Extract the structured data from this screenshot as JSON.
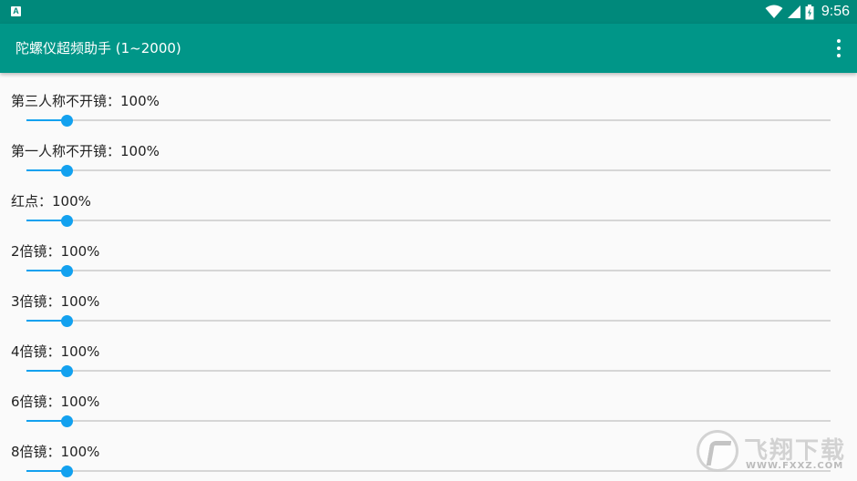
{
  "status_bar": {
    "time": "9:56",
    "app_icon_letter": "A",
    "icons": [
      "notification-icon",
      "wifi-icon",
      "signal-icon",
      "battery-icon"
    ]
  },
  "app_bar": {
    "title": "陀螺仪超频助手 (1~2000)",
    "overflow_icon": "more-vert-icon"
  },
  "sliders": [
    {
      "label": "第三人称不开镜：100%",
      "value": 100,
      "min": 1,
      "max": 2000
    },
    {
      "label": "第一人称不开镜：100%",
      "value": 100,
      "min": 1,
      "max": 2000
    },
    {
      "label": "红点：100%",
      "value": 100,
      "min": 1,
      "max": 2000
    },
    {
      "label": "2倍镜：100%",
      "value": 100,
      "min": 1,
      "max": 2000
    },
    {
      "label": "3倍镜：100%",
      "value": 100,
      "min": 1,
      "max": 2000
    },
    {
      "label": "4倍镜：100%",
      "value": 100,
      "min": 1,
      "max": 2000
    },
    {
      "label": "6倍镜：100%",
      "value": 100,
      "min": 1,
      "max": 2000
    },
    {
      "label": "8倍镜：100%",
      "value": 100,
      "min": 1,
      "max": 2000
    }
  ],
  "colors": {
    "status_bar": "#00897b",
    "app_bar": "#009688",
    "slider_accent": "#13a1ef",
    "slider_track": "#d6d6d6",
    "background": "#fafafa"
  },
  "watermark": {
    "text": "飞翔下载",
    "domain": "WWW.FXXZ.COM"
  }
}
